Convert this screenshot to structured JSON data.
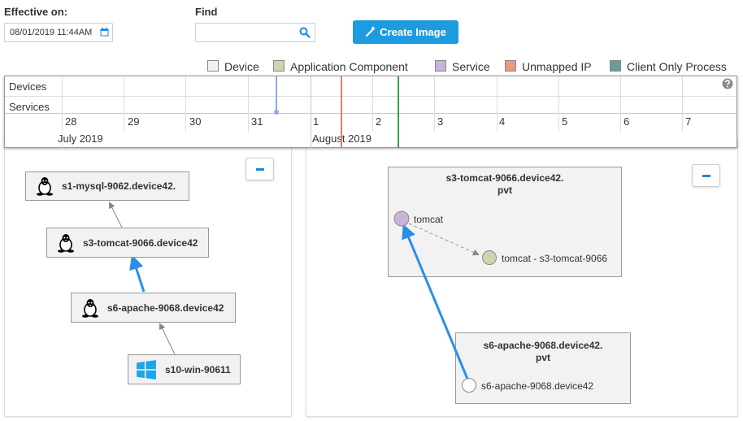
{
  "header": {
    "effective_label": "Effective on:",
    "effective_value": "08/01/2019 11:44AM",
    "find_label": "Find",
    "find_value": "",
    "create_button": "Create Image"
  },
  "legend": [
    {
      "label": "Device",
      "color": "#f2f2f2"
    },
    {
      "label": "Application Component",
      "color": "#cfd4ae"
    },
    {
      "label": "Service",
      "color": "#c9b3d6"
    },
    {
      "label": "Unmapped IP",
      "color": "#e89a80"
    },
    {
      "label": "Client Only Process",
      "color": "#6a9a9a"
    }
  ],
  "timeline": {
    "rows": [
      "Devices",
      "Services"
    ],
    "days": [
      "28",
      "29",
      "30",
      "31",
      "1",
      "2",
      "3",
      "4",
      "5",
      "6",
      "7"
    ],
    "months": [
      "July 2019",
      "August 2019"
    ],
    "help_icon": "question-circle-icon"
  },
  "left_graph": {
    "nodes": [
      {
        "label": "s1-mysql-9062.device42.",
        "icon": "linux-tux-icon"
      },
      {
        "label": "s3-tomcat-9066.device42",
        "icon": "linux-tux-icon"
      },
      {
        "label": "s6-apache-9068.device42",
        "icon": "linux-tux-icon"
      },
      {
        "label": "s10-win-90611",
        "icon": "windows-icon"
      }
    ]
  },
  "right_graph": {
    "groups": [
      {
        "title_line1": "s3-tomcat-9066.device42.",
        "title_line2": "pvt",
        "services": [
          "tomcat",
          "tomcat - s3-tomcat-9066"
        ]
      },
      {
        "title_line1": "s6-apache-9068.device42.",
        "title_line2": "pvt",
        "services": [
          "s6-apache-9068.device42"
        ]
      }
    ]
  },
  "colors": {
    "accent": "#1e9be0",
    "edge_active": "#2b8fe8",
    "edge_default": "#888888",
    "marker_current": "#8fa8e8",
    "marker_red": "#e07b6a",
    "marker_green": "#2eaa4a"
  }
}
